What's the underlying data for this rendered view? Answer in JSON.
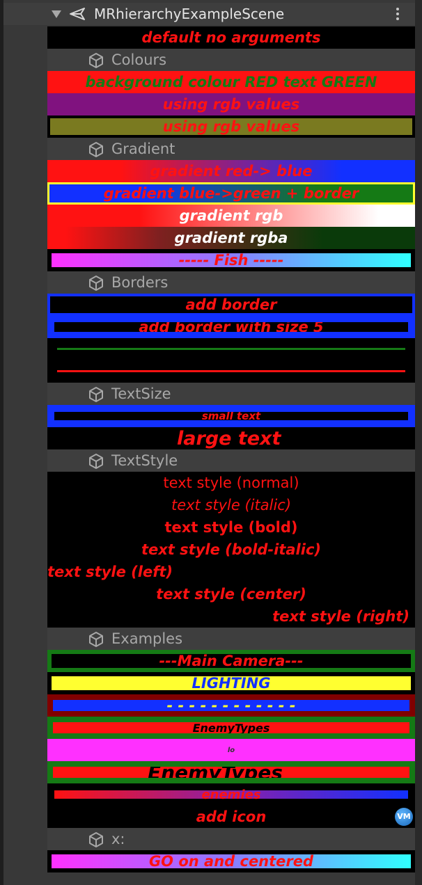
{
  "scene": {
    "title": "MRhierarchyExampleScene"
  },
  "groups": {
    "colours": "Colours",
    "gradient": "Gradient",
    "borders": "Borders",
    "textsize": "TextSize",
    "textstyle": "TextStyle",
    "examples": "Examples",
    "x": "x:"
  },
  "rows": {
    "default": "default no arguments",
    "bg_red": "background colour RED text GREEN",
    "rgb1": "using rgb values",
    "rgb2": "using rgb values",
    "grad_rb": "gradient red-> blue",
    "grad_bg": "gradient blue->green + border",
    "grad_rgb": "gradient rgb",
    "grad_rgba": "gradient rgba",
    "fish": "----- Fish -----",
    "add_border": "add border",
    "add_border5": "add border with size 5",
    "small": "small text",
    "large": "large text",
    "ts_normal": "text style (normal)",
    "ts_italic": "text style (italic)",
    "ts_bold": "text style (bold)",
    "ts_bolditalic": "text style (bold-italic)",
    "ts_left": "text style (left)",
    "ts_center": "text style (center)",
    "ts_right": "text style (right)",
    "main_camera": "---Main Camera---",
    "lighting": "LIGHTING",
    "dashes": "- - - - - - - - - - - -",
    "enemytypes_small": "EnemyTypes",
    "lo": "lo",
    "enemytypes_large": "EnemyTypes",
    "enemies": "enemies",
    "add_icon": "add icon",
    "icon_text": "VM",
    "go_on": "GO on and centered"
  },
  "colors": {
    "red": "#ff1212",
    "blue": "#1230ff",
    "green": "#157a15",
    "yellow": "#ffff30",
    "magenta": "#ff30ff",
    "cyan": "#30ffff"
  }
}
